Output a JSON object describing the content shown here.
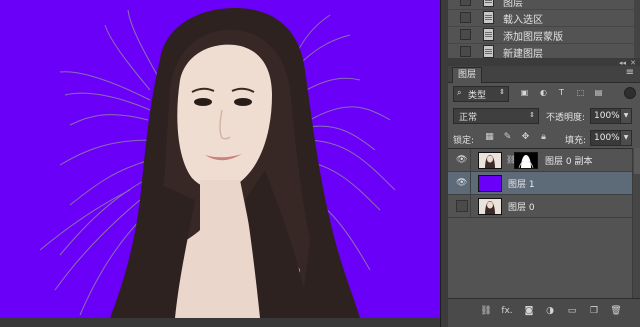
{
  "canvas": {
    "background_color": "#6b00f8",
    "image": "portrait-woman-long-hair-on-purple"
  },
  "history": {
    "items": [
      {
        "label": "图层"
      },
      {
        "label": "载入选区"
      },
      {
        "label": "添加图层蒙版"
      },
      {
        "label": "新建图层"
      }
    ]
  },
  "layers_panel": {
    "tab_label": "图层",
    "filter": {
      "label": "类型",
      "icons": [
        "image-filter-icon",
        "adjustment-filter-icon",
        "type-filter-icon",
        "shape-filter-icon",
        "smart-object-filter-icon"
      ]
    },
    "blend_mode": "正常",
    "opacity_label": "不透明度:",
    "opacity_value": "100%",
    "lock_label": "锁定:",
    "fill_label": "填充:",
    "fill_value": "100%",
    "layers": [
      {
        "name": "图层 0 副本",
        "visible": true,
        "selected": false,
        "has_mask": true
      },
      {
        "name": "图层 1",
        "visible": true,
        "selected": true,
        "has_mask": false
      },
      {
        "name": "图层 0",
        "visible": false,
        "selected": false,
        "has_mask": false
      }
    ],
    "footer_icons": [
      "link-layers-icon",
      "fx-icon",
      "add-mask-icon",
      "adjustment-layer-icon",
      "new-group-icon",
      "new-layer-icon",
      "delete-icon"
    ],
    "fx_label": "fx.",
    "selected_color": "#5d6a78"
  }
}
